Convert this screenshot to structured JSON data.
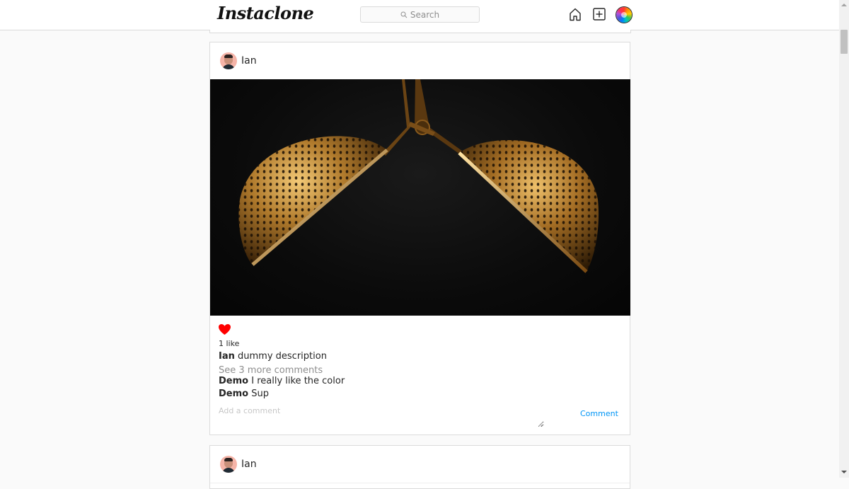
{
  "header": {
    "logo": "Instaclone",
    "search": {
      "label": "Search",
      "icon": "search-icon"
    },
    "nav": [
      {
        "icon": "home-icon"
      },
      {
        "icon": "add-post-icon"
      },
      {
        "icon": "profile-avatar"
      }
    ]
  },
  "posts": [
    {
      "username": "Ian",
      "image": "golden-strainers-photo",
      "liked": true,
      "likes_text": "1 like",
      "caption": {
        "user": "Ian",
        "text": "dummy description"
      },
      "more_comments": "See 3 more comments",
      "comments": [
        {
          "user": "Demo",
          "text": "I really like the color"
        },
        {
          "user": "Demo",
          "text": "Sup"
        }
      ],
      "comment_placeholder": "Add a comment",
      "comment_button": "Comment"
    },
    {
      "username": "Ian"
    }
  ],
  "colors": {
    "background": "#fafafa",
    "border": "#dbdbdb",
    "like_red": "#ff0000",
    "link_blue": "#0095f6",
    "muted": "#8e8e8e"
  }
}
